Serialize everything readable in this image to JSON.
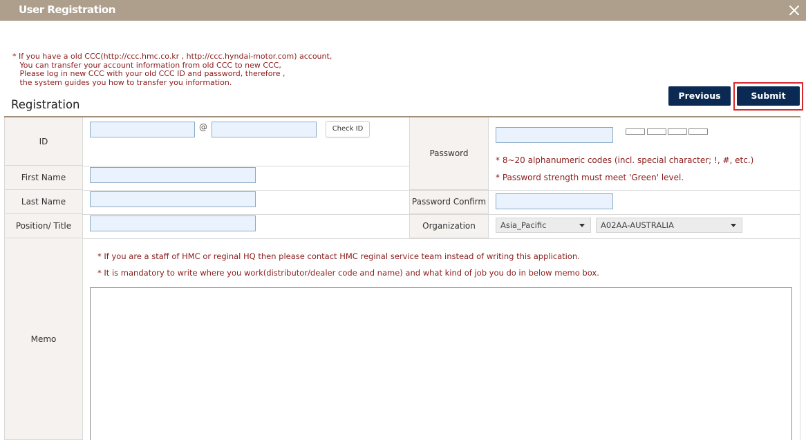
{
  "window": {
    "title": "User Registration",
    "close_icon": "close-icon"
  },
  "notice": {
    "lines": [
      "* If you have a old CCC(http://ccc.hmc.co.kr , http://ccc.hyndai-motor.com) account,",
      "   You can transfer your account information from old CCC to new CCC,",
      "   Please log in new CCC with your old CCC ID and password, therefore ,",
      "   the system guides you how to transfer you information."
    ]
  },
  "buttons": {
    "previous": "Previous",
    "submit": "Submit"
  },
  "section": {
    "title": "Registration"
  },
  "form": {
    "id_label": "ID",
    "at_sign": "@",
    "check_id": "Check ID",
    "first_name_label": "First Name",
    "last_name_label": "Last Name",
    "position_label": "Position/ Title",
    "password_label": "Password",
    "password_hint_1": "* 8~20 alphanumeric codes (incl. special character; !, #, etc.)",
    "password_hint_2": "* Password strength must meet 'Green' level.",
    "password_confirm_label": "Password Confirm",
    "organization_label": "Organization",
    "region_select": "Asia_Pacific",
    "org_select": "A02AA-AUSTRALIA",
    "memo_label": "Memo",
    "memo_hint_1": "* If you are a staff of HMC or reginal HQ then please contact HMC reginal service team instead of writing this application.",
    "memo_hint_2": "* It is mandatory to write where you work(distributor/dealer code and name) and what kind of job you do in below memo box."
  },
  "colors": {
    "titlebar": "#ae9f8d",
    "button": "#0b2a53",
    "notice_text": "#8b1a1a",
    "highlight": "#d9262b",
    "label_bg": "#f5f2f0",
    "input_bg": "#eaf3fd"
  }
}
